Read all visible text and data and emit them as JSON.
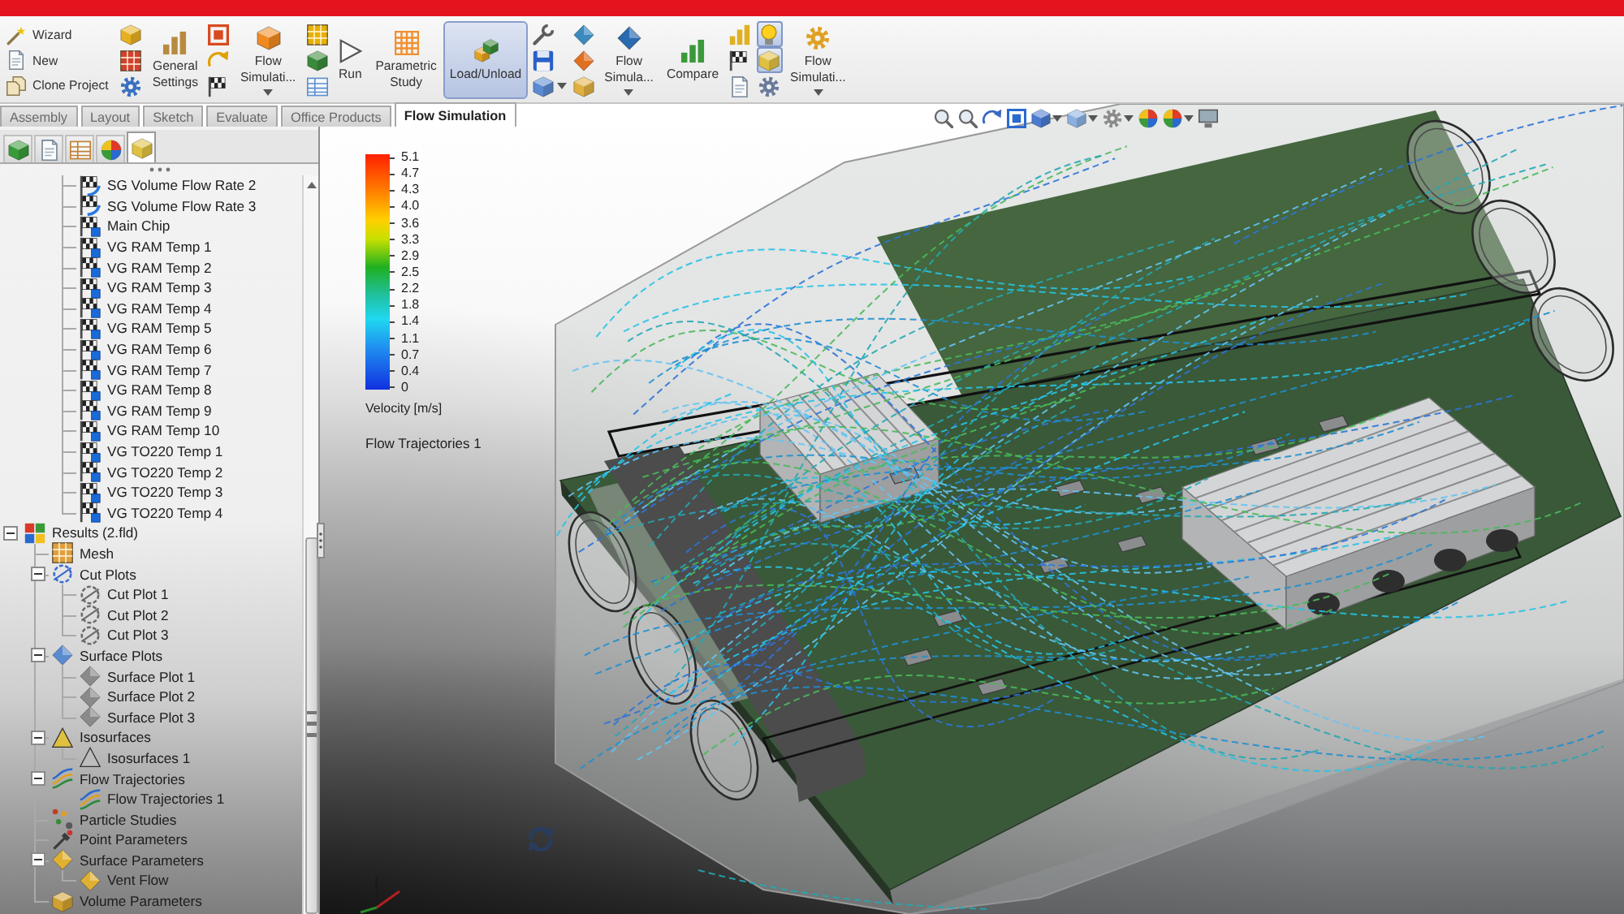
{
  "ribbon": [
    {
      "kind": "stack",
      "items": [
        {
          "label": "Wizard"
        },
        {
          "label": "New"
        },
        {
          "label": "Clone Project"
        }
      ]
    },
    {
      "kind": "icons",
      "buttons": [
        {
          "selected": false,
          "dropdown": false
        },
        {
          "selected": false,
          "dropdown": false
        },
        {
          "selected": false,
          "dropdown": false
        }
      ]
    },
    {
      "kind": "large",
      "label": "General Settings",
      "selected": false,
      "dropdown": false
    },
    {
      "kind": "icons",
      "buttons": [
        {
          "selected": false,
          "dropdown": false
        },
        {
          "selected": false,
          "dropdown": false
        },
        {
          "selected": false,
          "dropdown": false
        }
      ]
    },
    {
      "kind": "large",
      "label": "Flow Simulati...",
      "selected": false,
      "dropdown": true
    },
    {
      "kind": "icons",
      "buttons": [
        {
          "selected": false,
          "dropdown": false
        },
        {
          "selected": false,
          "dropdown": false
        },
        {
          "selected": false,
          "dropdown": false
        }
      ]
    },
    {
      "kind": "large",
      "label": "Run",
      "selected": false,
      "dropdown": false
    },
    {
      "kind": "large",
      "label": "Parametric Study",
      "selected": false,
      "dropdown": false
    },
    {
      "kind": "large",
      "label": "Load/Unload",
      "selected": true,
      "dropdown": false
    },
    {
      "kind": "icons",
      "buttons": [
        {
          "selected": false,
          "dropdown": false
        },
        {
          "selected": false,
          "dropdown": false
        },
        {
          "selected": false,
          "dropdown": true
        }
      ]
    },
    {
      "kind": "icons",
      "buttons": [
        {
          "selected": false,
          "dropdown": false
        },
        {
          "selected": false,
          "dropdown": false
        },
        {
          "selected": false,
          "dropdown": false
        }
      ]
    },
    {
      "kind": "large",
      "label": "Flow Simula...",
      "selected": false,
      "dropdown": true
    },
    {
      "kind": "large",
      "label": "Compare",
      "selected": false,
      "dropdown": false
    },
    {
      "kind": "icons",
      "buttons": [
        {
          "selected": false,
          "dropdown": false
        },
        {
          "selected": false,
          "dropdown": false
        },
        {
          "selected": false,
          "dropdown": false
        }
      ]
    },
    {
      "kind": "icons",
      "buttons": [
        {
          "selected": true,
          "dropdown": false
        },
        {
          "selected": true,
          "dropdown": false
        },
        {
          "selected": false,
          "dropdown": false
        }
      ]
    },
    {
      "kind": "large",
      "label": "Flow Simulati...",
      "selected": false,
      "dropdown": true
    }
  ],
  "tabs": [
    {
      "label": "Assembly",
      "selected": false
    },
    {
      "label": "Layout",
      "selected": false
    },
    {
      "label": "Sketch",
      "selected": false
    },
    {
      "label": "Evaluate",
      "selected": false
    },
    {
      "label": "Office Products",
      "selected": false
    },
    {
      "label": "Flow Simulation",
      "selected": true
    }
  ],
  "view_toolbar": [
    {
      "dropdown": false
    },
    {
      "dropdown": false
    },
    {
      "dropdown": false
    },
    {
      "dropdown": false
    },
    {
      "dropdown": true
    },
    {
      "dropdown": true
    },
    {
      "dropdown": true
    },
    {
      "dropdown": false
    },
    {
      "dropdown": true
    },
    {
      "dropdown": false
    }
  ],
  "feature_panel": {
    "tabs": [
      {
        "selected": false
      },
      {
        "selected": false
      },
      {
        "selected": false
      },
      {
        "selected": false
      },
      {
        "selected": true
      }
    ],
    "tree": {
      "goal_items": [
        {
          "label": "SG Volume Flow Rate 2",
          "kind": "surface_goal"
        },
        {
          "label": "SG Volume Flow Rate 3",
          "kind": "surface_goal"
        },
        {
          "label": "Main Chip",
          "kind": "volume_goal"
        },
        {
          "label": "VG RAM Temp 1",
          "kind": "volume_goal"
        },
        {
          "label": "VG RAM Temp 2",
          "kind": "volume_goal"
        },
        {
          "label": "VG RAM Temp 3",
          "kind": "volume_goal"
        },
        {
          "label": "VG RAM Temp 4",
          "kind": "volume_goal"
        },
        {
          "label": "VG RAM Temp 5",
          "kind": "volume_goal"
        },
        {
          "label": "VG RAM Temp 6",
          "kind": "volume_goal"
        },
        {
          "label": "VG RAM Temp 7",
          "kind": "volume_goal"
        },
        {
          "label": "VG RAM Temp 8",
          "kind": "volume_goal"
        },
        {
          "label": "VG RAM Temp 9",
          "kind": "volume_goal"
        },
        {
          "label": "VG RAM Temp 10",
          "kind": "volume_goal"
        },
        {
          "label": "VG TO220 Temp 1",
          "kind": "volume_goal"
        },
        {
          "label": "VG TO220 Temp 2",
          "kind": "volume_goal"
        },
        {
          "label": "VG TO220 Temp 3",
          "kind": "volume_goal"
        },
        {
          "label": "VG TO220 Temp 4",
          "kind": "volume_goal"
        }
      ],
      "items": [
        {
          "label": "Results (2.fld)",
          "kind": "results",
          "expanded": true,
          "children": [
            {
              "label": "Mesh",
              "kind": "mesh"
            },
            {
              "label": "Cut Plots",
              "kind": "cut_plot",
              "expanded": true,
              "children": [
                {
                  "label": "Cut Plot 1",
                  "kind": "cut_plot"
                },
                {
                  "label": "Cut Plot 2",
                  "kind": "cut_plot"
                },
                {
                  "label": "Cut Plot 3",
                  "kind": "cut_plot"
                }
              ]
            },
            {
              "label": "Surface Plots",
              "kind": "surface_plot",
              "expanded": true,
              "children": [
                {
                  "label": "Surface Plot 1",
                  "kind": "surface_plot"
                },
                {
                  "label": "Surface Plot 2",
                  "kind": "surface_plot"
                },
                {
                  "label": "Surface Plot 3",
                  "kind": "surface_plot"
                }
              ]
            },
            {
              "label": "Isosurfaces",
              "kind": "isosurface",
              "expanded": true,
              "children": [
                {
                  "label": "Isosurfaces 1",
                  "kind": "isosurface"
                }
              ]
            },
            {
              "label": "Flow Trajectories",
              "kind": "flow_trajectory",
              "expanded": true,
              "children": [
                {
                  "label": "Flow Trajectories 1",
                  "kind": "flow_trajectory"
                }
              ]
            },
            {
              "label": "Particle Studies",
              "kind": "particle_study"
            },
            {
              "label": "Point Parameters",
              "kind": "point_parameter"
            },
            {
              "label": "Surface Parameters",
              "kind": "surface_parameter",
              "expanded": true,
              "children": [
                {
                  "label": "Vent Flow",
                  "kind": "surface_parameter"
                }
              ]
            },
            {
              "label": "Volume Parameters",
              "kind": "volume_parameter"
            }
          ]
        }
      ]
    }
  },
  "viewport": {
    "legend": {
      "ticks": [
        "5.1",
        "4.7",
        "4.3",
        "4.0",
        "3.6",
        "3.3",
        "2.9",
        "2.5",
        "2.2",
        "1.8",
        "1.4",
        "1.1",
        "0.7",
        "0.4",
        "0"
      ],
      "quantity": "Velocity [m/s]"
    },
    "plot_title": "Flow Trajectories 1"
  }
}
